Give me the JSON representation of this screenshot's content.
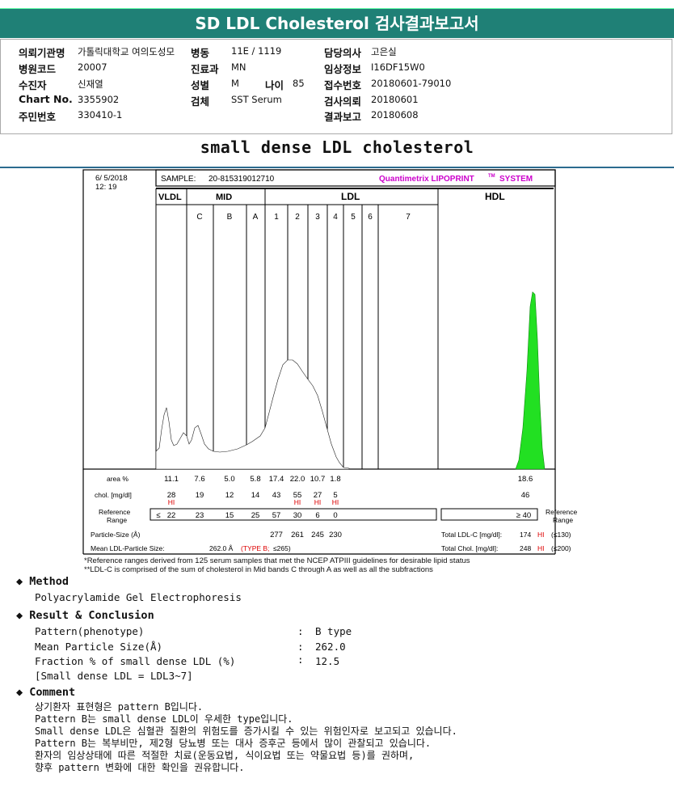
{
  "header": {
    "title": "SD LDL Cholesterol 검사결과보고서"
  },
  "info": {
    "institution_label": "의뢰기관명",
    "institution_value": "가톨릭대학교 여의도성모",
    "ward_label": "병동",
    "ward_value": "11E / 1119",
    "doctor_label": "담당의사",
    "doctor_value": "고은실",
    "hospital_code_label": "병원코드",
    "hospital_code_value": "20007",
    "dept_label": "진료과",
    "dept_value": "MN",
    "clinical_label": "임상정보",
    "clinical_value": "I16DF15W0",
    "patient_label": "수진자",
    "patient_value": "신재열",
    "sex_label": "성별",
    "sex_value": "M",
    "age_label": "나이",
    "age_value": "85",
    "receipt_label": "접수번호",
    "receipt_value": "20180601-79010",
    "chart_label": "Chart No.",
    "chart_value": "3355902",
    "specimen_label": "검체",
    "specimen_value": "SST Serum",
    "request_label": "검사의뢰",
    "request_value": "20180601",
    "id_label": "주민번호",
    "id_value": "330410-1",
    "report_label": "결과보고",
    "report_value": "20180608"
  },
  "section_title": "small dense LDL cholesterol",
  "chart": {
    "date": "6/ 5/2018",
    "time": "12: 19",
    "sample_label": "SAMPLE:",
    "sample_value": "20-815319012710",
    "brand": "Quantimetrix LIPOPRINT",
    "brand_tm": "TM",
    "brand_suffix": "SYSTEM",
    "group_vldl": "VLDL",
    "group_mid": "MID",
    "group_ldl": "LDL",
    "group_hdl": "HDL",
    "row_area_label": "area %",
    "row_chol_label": "chol. [mg/dl]",
    "row_ref_label1": "Reference",
    "row_ref_label2": "Range",
    "row_ref_right1": "Reference",
    "row_ref_right2": "Range",
    "hi_text": "HI",
    "ref_first_prefix": "≤",
    "hdl_ref_value": "≥ 40",
    "particle_label": "Particle-Size (Å)",
    "total_ldl_label": "Total LDL-C [mg/dl]:",
    "total_ldl_value": "174",
    "total_ldl_flag": "HI",
    "total_ldl_ref": "(≤130)",
    "mean_ldl_label": "Mean LDL-Particle Size:",
    "mean_ldl_value": "262.0 Å",
    "mean_ldl_type": "(TYPE B;",
    "mean_ldl_ref": "≤265)",
    "total_chol_label": "Total Chol. [mg/dl]:",
    "total_chol_value": "248",
    "total_chol_flag": "HI",
    "total_chol_ref": "(≤200)",
    "foot1": "*Reference ranges derived from 125 serum samples that met the NCEP ATPIII guidelines for desirable lipid status",
    "foot2": "**LDL-C is comprised of the sum of cholesterol in Mid bands C through A as well as all the subfractions"
  },
  "chart_data": {
    "type": "table",
    "bands": [
      "VLDL",
      "C",
      "B",
      "A",
      "1",
      "2",
      "3",
      "4",
      "5",
      "6",
      "7",
      "HDL"
    ],
    "band_labels": [
      "C",
      "B",
      "A",
      "1",
      "2",
      "3",
      "4",
      "5",
      "6",
      "7"
    ],
    "area_pct": [
      "11.1",
      "7.6",
      "5.0",
      "5.8",
      "17.4",
      "22.0",
      "10.7",
      "1.8",
      "18.6"
    ],
    "chol": [
      "28",
      "19",
      "12",
      "14",
      "43",
      "55",
      "27",
      "5",
      "46"
    ],
    "chol_hi": [
      true,
      false,
      false,
      false,
      false,
      true,
      true,
      true,
      false
    ],
    "reference": [
      "22",
      "23",
      "15",
      "25",
      "57",
      "30",
      "6",
      "0"
    ],
    "particle_size": [
      "277",
      "261",
      "245",
      "230"
    ]
  },
  "method": {
    "title": "Method",
    "text": "Polyacrylamide Gel Electrophoresis"
  },
  "result": {
    "title": "Result & Conclusion",
    "rows": [
      {
        "label": "Pattern(phenotype)",
        "colon": ":",
        "value": "B type"
      },
      {
        "label": "Mean Particle Size(Å)",
        "colon": ":",
        "value": "262.0"
      },
      {
        "label": "Fraction % of small dense LDL (%)",
        "colon": ":",
        "value": "12.5"
      }
    ],
    "note": "[Small dense LDL = LDL3~7]"
  },
  "comment": {
    "title": "Comment",
    "lines": [
      "상기환자 표현형은 pattern B입니다.",
      "Pattern B는 small dense LDL이 우세한 type입니다.",
      "Small dense LDL은 심혈관 질환의 위험도를 증가시킬 수 있는 위험인자로 보고되고 있습니다.",
      "Pattern B는 복부비만, 제2형 당뇨병 또는 대사 증후군 등에서 많이 관찰되고 있습니다.",
      "환자의 임상상태에 따른 적절한 치료(운동요법, 식이요법 또는 약물요법 등)를 권하며,",
      "향후 pattern 변화에 대한 확인을 권유합니다."
    ]
  },
  "colors": {
    "header": "#1f8076",
    "brand": "#cc00cc",
    "hi": "#dd0000"
  }
}
